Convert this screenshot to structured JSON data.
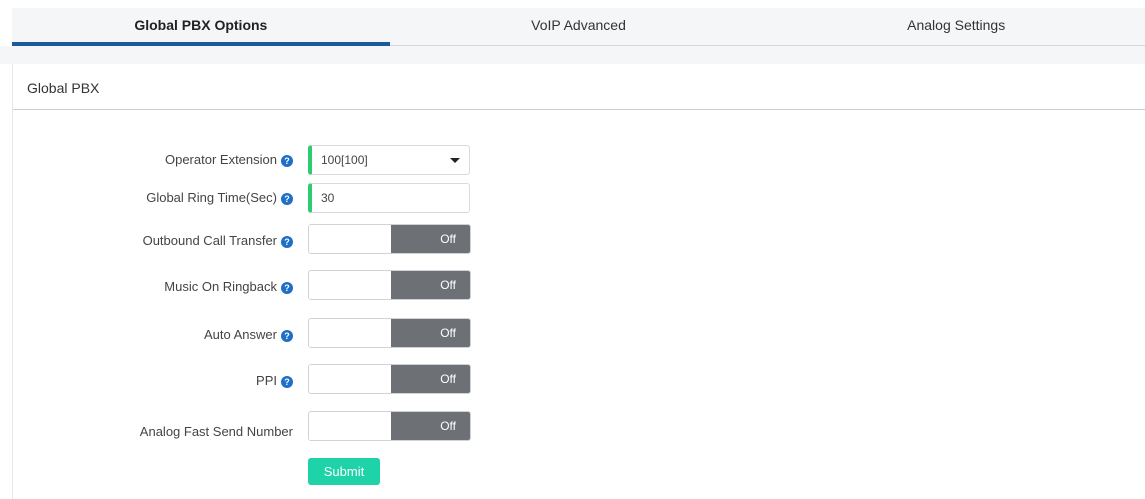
{
  "tabs": [
    {
      "label": "Global PBX Options",
      "active": true
    },
    {
      "label": "VoIP Advanced",
      "active": false
    },
    {
      "label": "Analog Settings",
      "active": false
    }
  ],
  "panel": {
    "title": "Global PBX"
  },
  "form": {
    "operator_extension": {
      "label": "Operator Extension",
      "value": "100[100]"
    },
    "global_ring_time": {
      "label": "Global Ring Time(Sec)",
      "value": "30"
    },
    "outbound_call_transfer": {
      "label": "Outbound Call Transfer",
      "state": "Off"
    },
    "music_on_ringback": {
      "label": "Music On Ringback",
      "state": "Off"
    },
    "auto_answer": {
      "label": "Auto Answer",
      "state": "Off"
    },
    "ppi": {
      "label": "PPI",
      "state": "Off"
    },
    "analog_fast_send_number": {
      "label": "Analog Fast Send Number",
      "state": "Off"
    },
    "submit_label": "Submit"
  },
  "colors": {
    "active_tab_underline": "#1b5a9c",
    "field_accent": "#2ecc71",
    "toggle_off": "#6d7074",
    "submit": "#1fd3a8",
    "help_icon": "#1f6fc6"
  }
}
